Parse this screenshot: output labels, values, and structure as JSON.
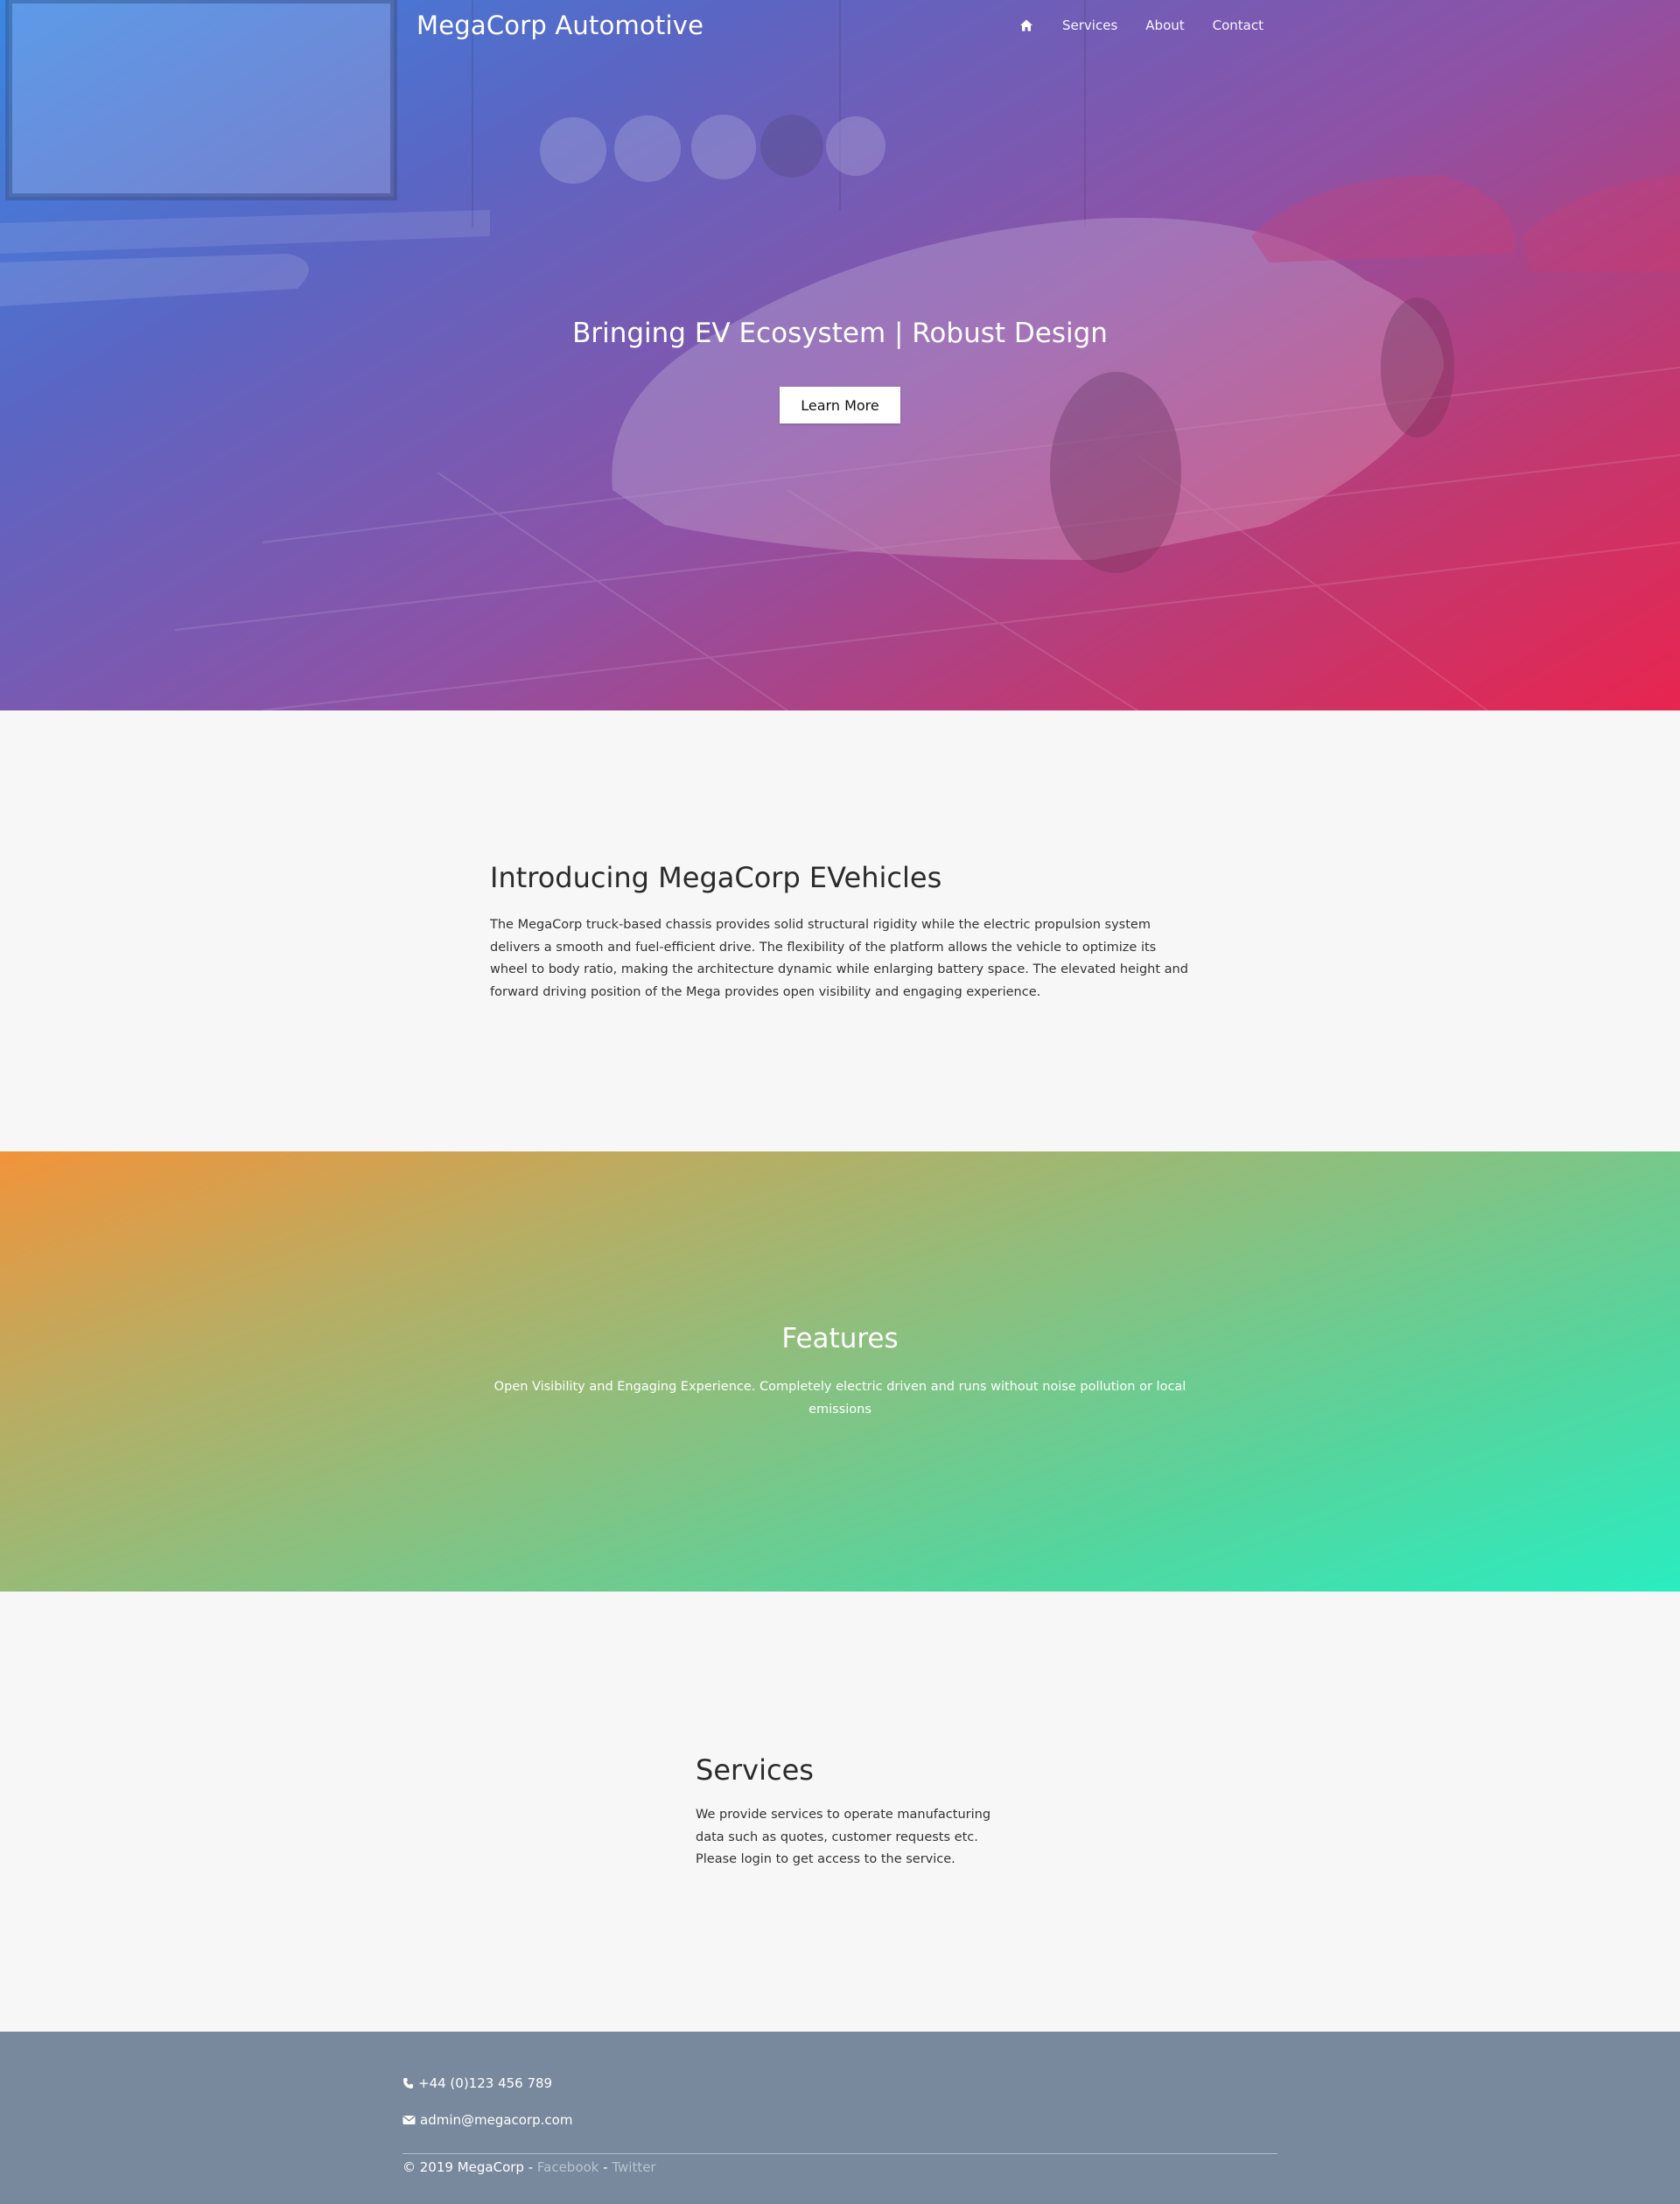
{
  "nav": {
    "brand": "MegaCorp Automotive",
    "home_icon": "home-icon",
    "links": [
      "Services",
      "About",
      "Contact"
    ]
  },
  "hero": {
    "title": "Bringing EV Ecosystem | Robust Design",
    "button": "Learn More",
    "gradient": [
      "#3a86e4",
      "#8e52a6",
      "#e8254f"
    ]
  },
  "intro": {
    "title": "Introducing MegaCorp EVehicles",
    "body": "The MegaCorp truck-based chassis provides solid structural rigidity while the electric propulsion system delivers a smooth and fuel-efficient drive. The flexibility of the platform allows the vehicle to optimize its wheel to body ratio, making the architecture dynamic while enlarging battery space. The elevated height and forward driving position of the Mega provides open visibility and engaging experience."
  },
  "features": {
    "title": "Features",
    "body": "Open Visibility and Engaging Experience. Completely electric driven and runs without noise pollution or local emissions",
    "gradient": [
      "#f2933a",
      "#2aecc0"
    ]
  },
  "services": {
    "title": "Services",
    "body": "We provide services to operate manufacturing data such as quotes, customer requests etc. Please login to get access to the service."
  },
  "footer": {
    "phone_icon": "phone-icon",
    "phone": "+44 (0)123 456 789",
    "email_icon": "envelope-icon",
    "email": "admin@megacorp.com",
    "copyright": "© 2019 MegaCorp - ",
    "separator": " - ",
    "facebook": "Facebook",
    "twitter": "Twitter",
    "background": "#78899d"
  }
}
